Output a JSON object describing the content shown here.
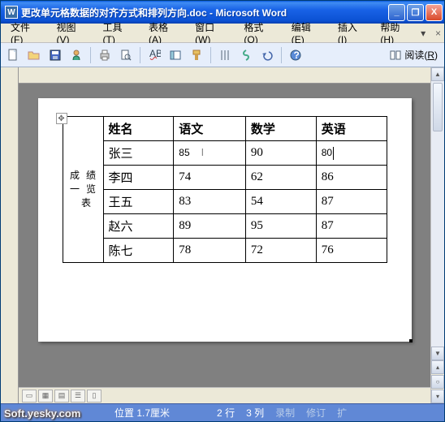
{
  "titlebar": {
    "icon_letter": "W",
    "title": "更改单元格数据的对齐方式和排列方向.doc - Microsoft Word"
  },
  "window_buttons": {
    "min": "_",
    "max": "❐",
    "close": "X"
  },
  "menubar": {
    "file": {
      "label": "文件",
      "accel": "F"
    },
    "view": {
      "label": "视图",
      "accel": "V"
    },
    "tools": {
      "label": "工具",
      "accel": "T"
    },
    "table": {
      "label": "表格",
      "accel": "A"
    },
    "window": {
      "label": "窗口",
      "accel": "W"
    },
    "format": {
      "label": "格式",
      "accel": "O"
    },
    "edit": {
      "label": "编辑",
      "accel": "E"
    },
    "insert": {
      "label": "插入",
      "accel": "I"
    },
    "help": {
      "label": "帮助",
      "accel": "H"
    },
    "question_placeholder": "▾"
  },
  "toolbar": {
    "reading_label": "阅读",
    "reading_accel": "R"
  },
  "icons": {
    "new": "new-icon",
    "open": "open-icon",
    "save": "save-icon",
    "permission": "permission-icon",
    "print": "print-icon",
    "preview": "preview-icon",
    "spell": "spell-icon",
    "research": "research-icon",
    "format-brush": "format-brush-icon",
    "show-marks": "show-marks-icon",
    "ruler": "ruler-icon",
    "zoom": "zoom-icon",
    "help": "help-icon",
    "reading": "reading-icon"
  },
  "document": {
    "side_title_rows": [
      {
        "a": "成",
        "b": "绩"
      },
      {
        "a": "一",
        "b": "览"
      },
      {
        "a": "",
        "b": "表"
      }
    ],
    "headers": [
      "姓名",
      "语文",
      "数学",
      "英语"
    ],
    "rows": [
      {
        "name": "张三",
        "chinese": "85",
        "math": "90",
        "english": "80",
        "cursor_after_english": true,
        "ibeam_after_chinese": true
      },
      {
        "name": "李四",
        "chinese": "74",
        "math": "62",
        "english": "86"
      },
      {
        "name": "王五",
        "chinese": "83",
        "math": "54",
        "english": "87"
      },
      {
        "name": "赵六",
        "chinese": "89",
        "math": "95",
        "english": "87"
      },
      {
        "name": "陈七",
        "chinese": "78",
        "math": "72",
        "english": "76"
      }
    ]
  },
  "statusbar": {
    "position_label": "位置",
    "position_value": "1.7厘米",
    "line_label": "行",
    "line_value": "2",
    "col_label": "列",
    "col_value": "3",
    "rec": "录制",
    "rev": "修订",
    "ext": "扩",
    "watermark": "Soft.yesky.com"
  },
  "colors": {
    "titlebar": "#1862e6",
    "toolbar_bg": "#e6eefb",
    "canvas_bg": "#808080",
    "status_bg": "#6088d6"
  }
}
